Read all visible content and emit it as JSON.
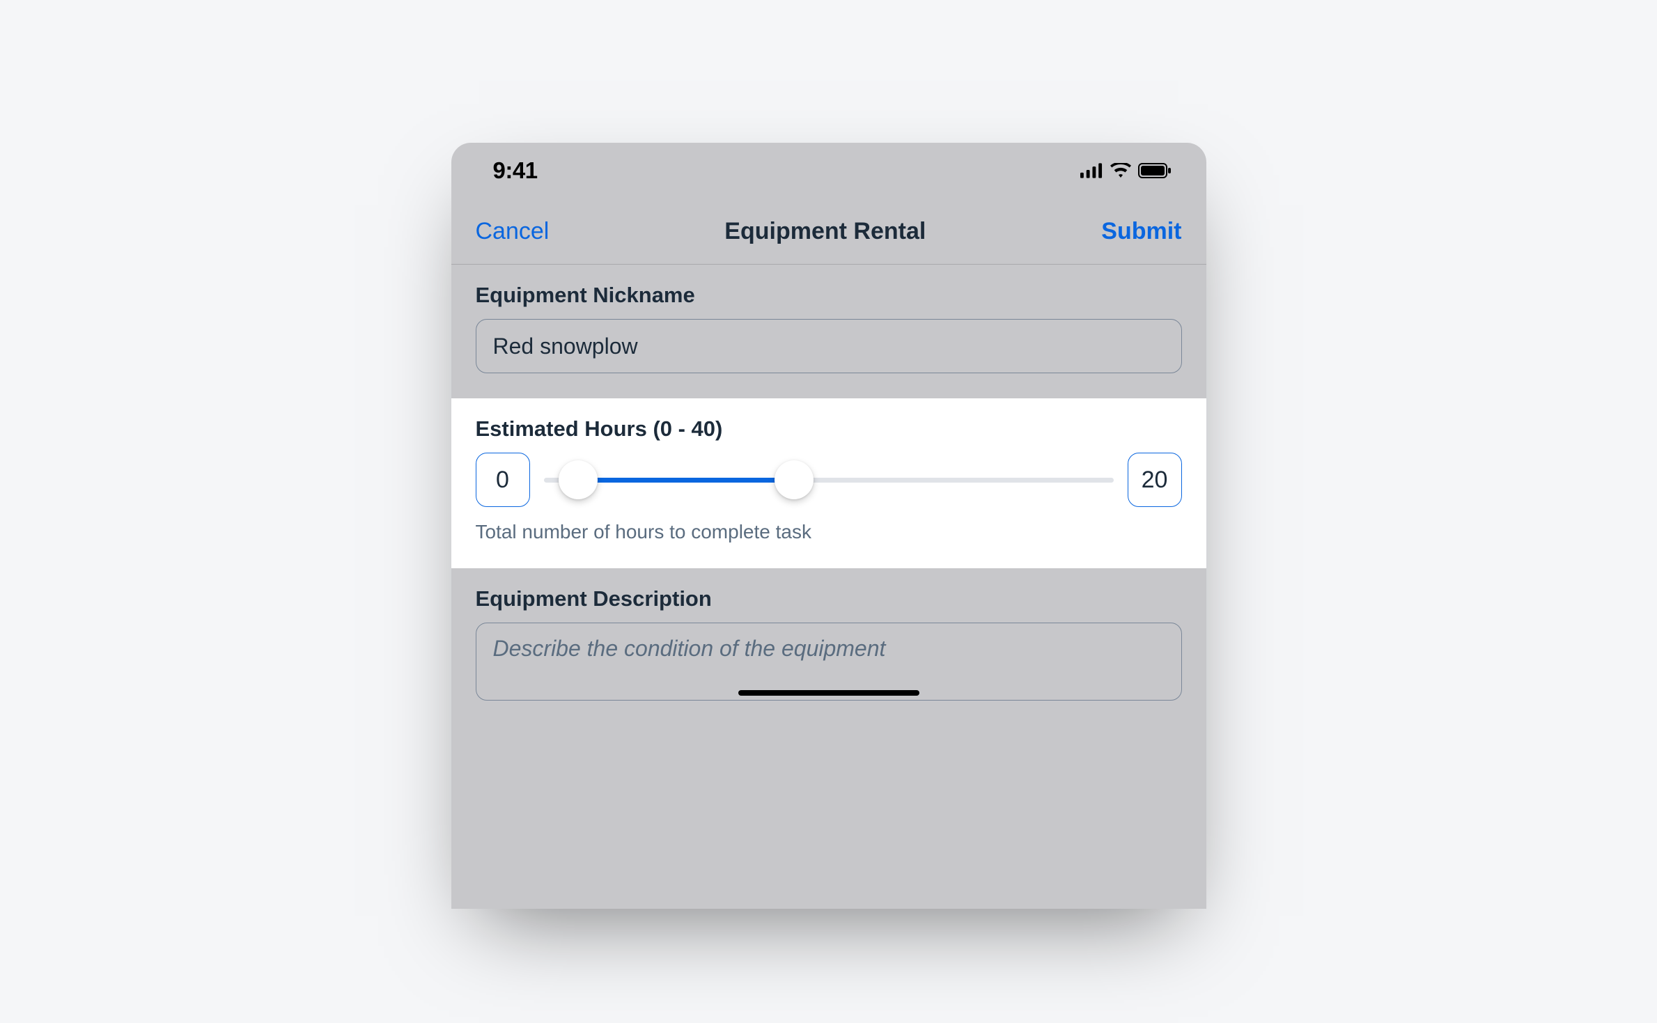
{
  "statusBar": {
    "time": "9:41"
  },
  "nav": {
    "cancel": "Cancel",
    "title": "Equipment Rental",
    "submit": "Submit"
  },
  "nickname": {
    "label": "Equipment Nickname",
    "value": "Red snowplow"
  },
  "hours": {
    "label": "Estimated Hours (0 - 40)",
    "minValue": "0",
    "maxValue": "20",
    "helper": "Total number of hours to complete task"
  },
  "description": {
    "label": "Equipment Description",
    "placeholder": "Describe the condition of the equipment"
  }
}
